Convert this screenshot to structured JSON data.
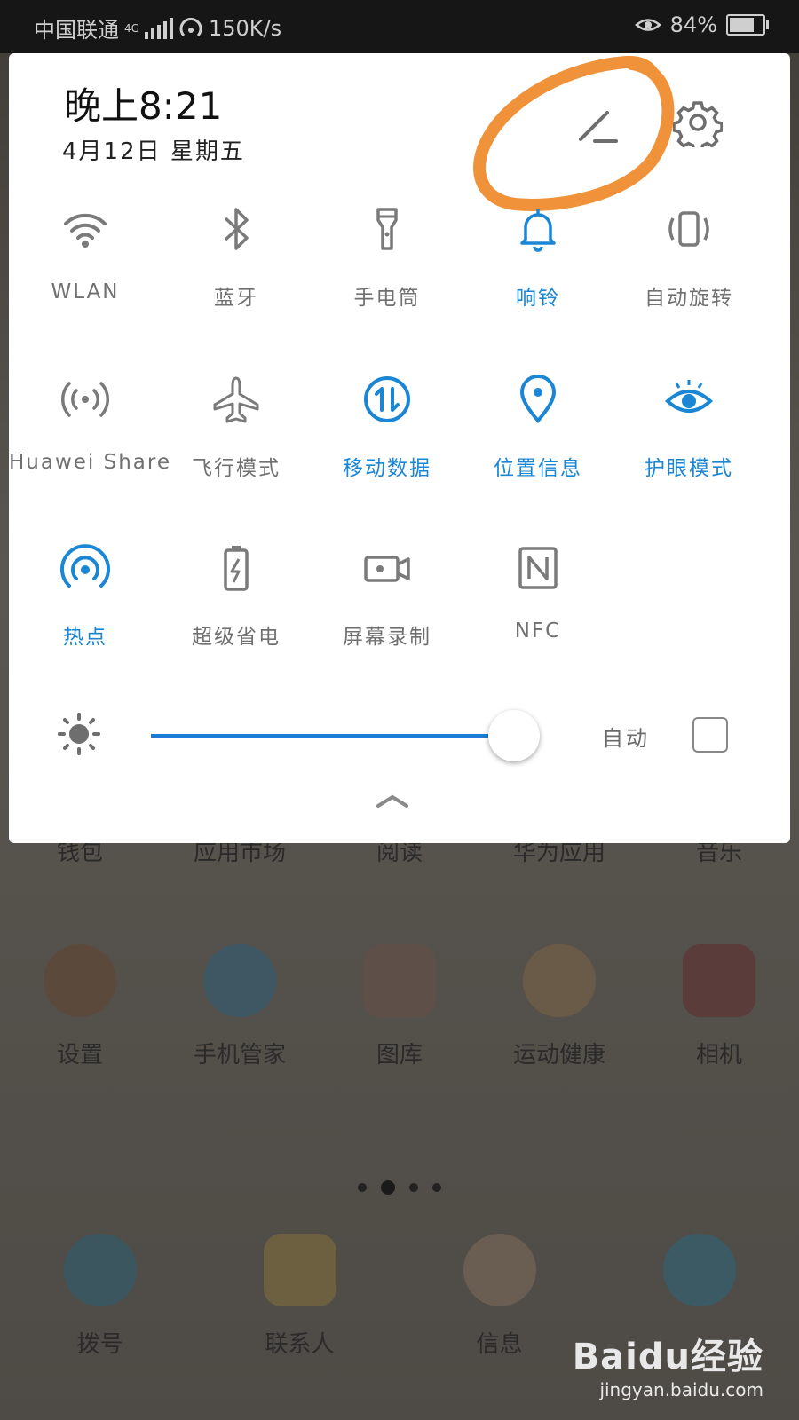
{
  "status_bar": {
    "carrier": "中国联通",
    "network": "4G",
    "speed": "150K/s",
    "battery": "84%",
    "battery_level": 0.84
  },
  "panel": {
    "time": "晚上8:21",
    "date": "4月12日 星期五",
    "tiles": [
      {
        "label": "WLAN",
        "icon": "wifi-icon",
        "active": false
      },
      {
        "label": "蓝牙",
        "icon": "bluetooth-icon",
        "active": false
      },
      {
        "label": "手电筒",
        "icon": "flashlight-icon",
        "active": false
      },
      {
        "label": "响铃",
        "icon": "bell-icon",
        "active": true
      },
      {
        "label": "自动旋转",
        "icon": "rotate-icon",
        "active": false
      },
      {
        "label": "Huawei Share",
        "icon": "share-icon",
        "active": false
      },
      {
        "label": "飞行模式",
        "icon": "airplane-icon",
        "active": false
      },
      {
        "label": "移动数据",
        "icon": "mobile-data-icon",
        "active": true
      },
      {
        "label": "位置信息",
        "icon": "location-icon",
        "active": true
      },
      {
        "label": "护眼模式",
        "icon": "eye-icon",
        "active": true
      },
      {
        "label": "热点",
        "icon": "hotspot-icon",
        "active": true
      },
      {
        "label": "超级省电",
        "icon": "battery-saver-icon",
        "active": false
      },
      {
        "label": "屏幕录制",
        "icon": "screen-record-icon",
        "active": false
      },
      {
        "label": "NFC",
        "icon": "nfc-icon",
        "active": false
      }
    ],
    "brightness_level": 0.93,
    "auto_label": "自动"
  },
  "home": {
    "row1": [
      "钱包",
      "应用市场",
      "阅读",
      "华为应用",
      "音乐"
    ],
    "row2": [
      "设置",
      "手机管家",
      "图库",
      "运动健康",
      "相机"
    ],
    "dock": [
      "拨号",
      "联系人",
      "信息",
      ""
    ]
  },
  "watermark": {
    "brand": "Baidu经验",
    "url": "jingyan.baidu.com"
  },
  "colors": {
    "accent": "#1a86d4",
    "annotation": "#f0923a"
  }
}
